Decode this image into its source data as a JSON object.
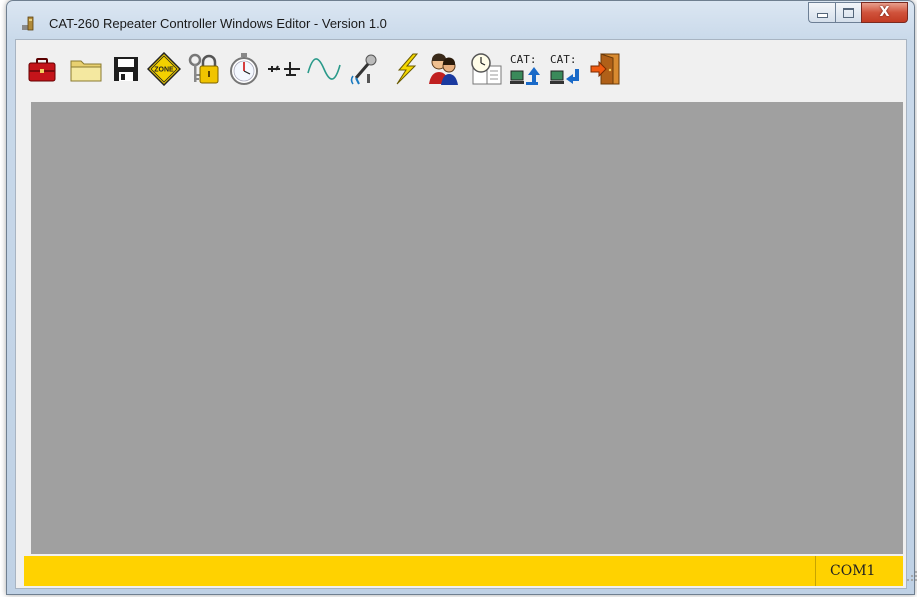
{
  "window": {
    "title": "CAT-260 Repeater Controller Windows Editor - Version 1.0"
  },
  "caption_buttons": {
    "minimize_icon": "minimize-icon",
    "maximize_icon": "maximize-icon",
    "close_label": "X"
  },
  "toolbar": {
    "buttons": [
      {
        "name": "toolbox-button",
        "icon": "toolbox-icon"
      },
      {
        "name": "open-button",
        "icon": "folder-icon"
      },
      {
        "name": "save-button",
        "icon": "floppy-disk-icon"
      },
      {
        "name": "zone-button",
        "icon": "zone-sign-icon",
        "label": "ZONE"
      },
      {
        "name": "security-button",
        "icon": "keys-padlock-icon"
      },
      {
        "name": "timer-button",
        "icon": "stopwatch-icon"
      },
      {
        "name": "antenna-button",
        "icon": "antenna-icon"
      },
      {
        "name": "waveform-button",
        "icon": "sine-wave-icon"
      },
      {
        "name": "microphone-button",
        "icon": "microphone-icon"
      },
      {
        "name": "lightning-button",
        "icon": "lightning-icon"
      },
      {
        "name": "users-button",
        "icon": "people-icon"
      },
      {
        "name": "schedule-button",
        "icon": "clock-book-icon"
      },
      {
        "name": "cat-upload-button",
        "icon": "cat-upload-icon",
        "label": "CAT:"
      },
      {
        "name": "cat-download-button",
        "icon": "cat-download-icon",
        "label": "CAT:"
      },
      {
        "name": "exit-button",
        "icon": "exit-door-icon"
      }
    ]
  },
  "statusbar": {
    "port": "COM1"
  },
  "colors": {
    "workspace": "#a0a0a0",
    "statusbar": "#ffd200"
  }
}
